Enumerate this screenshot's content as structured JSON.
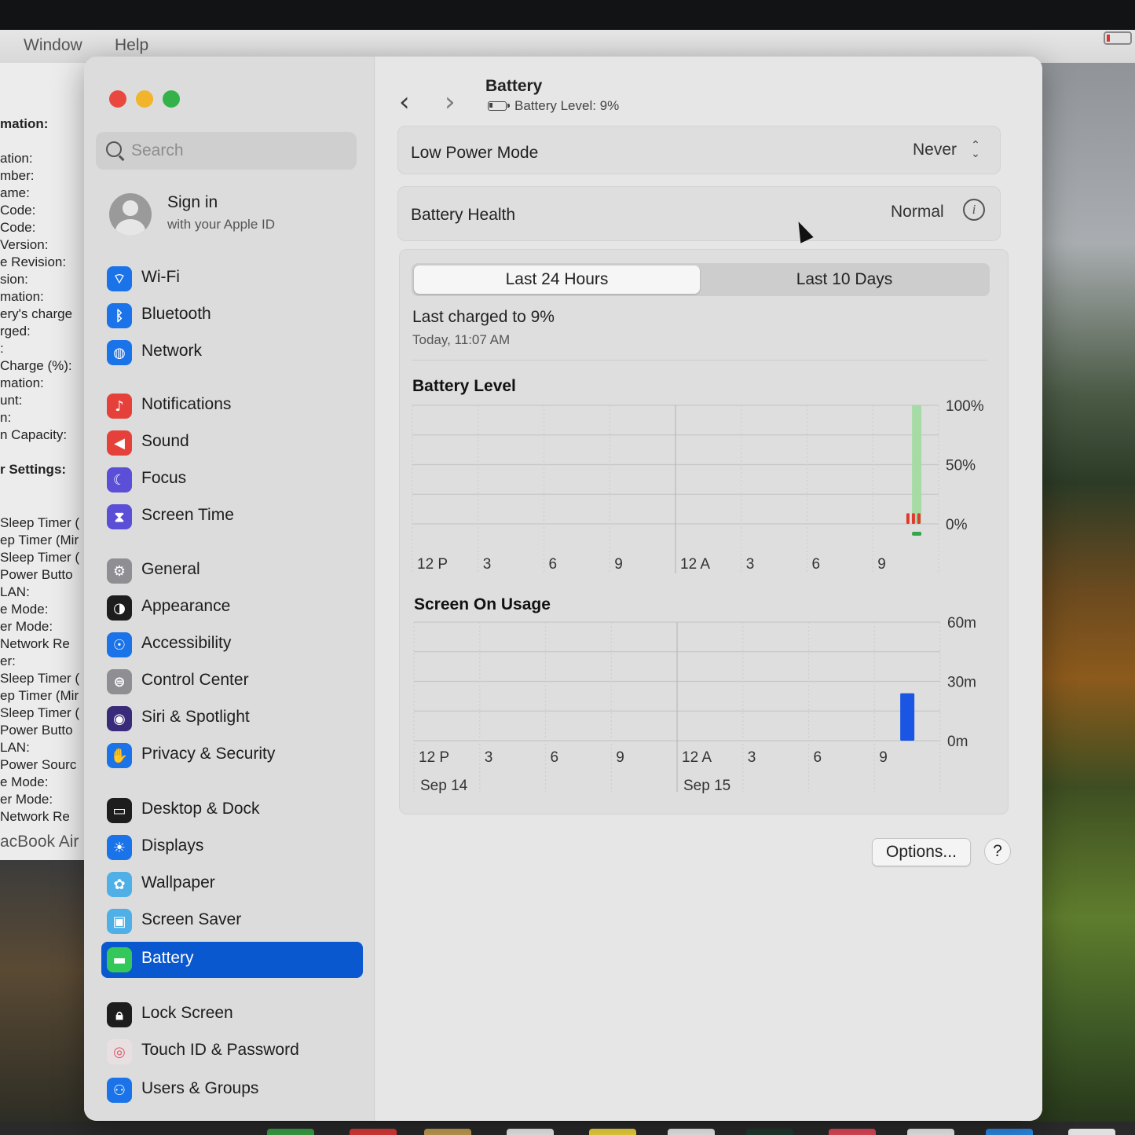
{
  "menubar": {
    "items": [
      "Window",
      "Help"
    ]
  },
  "info_window": {
    "lines": [
      "mation:",
      "ation:",
      "mber:",
      "ame:",
      "Code:",
      "Code:",
      "Version:",
      "e Revision:",
      "sion:",
      "mation:",
      "ery's charge",
      "rged:",
      ":",
      "Charge (%):",
      "mation:",
      "unt:",
      "n:",
      "n Capacity:",
      "r Settings:",
      "Sleep Timer (",
      "ep Timer (Mir",
      "Sleep Timer (",
      "Power Butto",
      "LAN:",
      "e Mode:",
      "er Mode:",
      "Network Re",
      "er:",
      "Sleep Timer (",
      "ep Timer (Mir",
      "Sleep Timer (",
      "Power Butto",
      "LAN:",
      "Power Sourc",
      "e Mode:",
      "er Mode:",
      "Network Re",
      "acBook Air"
    ]
  },
  "sidebar": {
    "search_placeholder": "Search",
    "account": {
      "title": "Sign in",
      "subtitle": "with your Apple ID"
    },
    "items": [
      {
        "label": "Wi-Fi",
        "icon": "wifi-icon",
        "color": "#1a73e8"
      },
      {
        "label": "Bluetooth",
        "icon": "bluetooth-icon",
        "color": "#1a73e8"
      },
      {
        "label": "Network",
        "icon": "globe-icon",
        "color": "#1a73e8"
      },
      {
        "label": "Notifications",
        "icon": "bell-icon",
        "color": "#e5413a"
      },
      {
        "label": "Sound",
        "icon": "speaker-icon",
        "color": "#e5413a"
      },
      {
        "label": "Focus",
        "icon": "moon-icon",
        "color": "#5a4fd6"
      },
      {
        "label": "Screen Time",
        "icon": "hourglass-icon",
        "color": "#5a4fd6"
      },
      {
        "label": "General",
        "icon": "gear-icon",
        "color": "#8e8e93"
      },
      {
        "label": "Appearance",
        "icon": "appearance-icon",
        "color": "#1d1d1d"
      },
      {
        "label": "Accessibility",
        "icon": "accessibility-icon",
        "color": "#1a73e8"
      },
      {
        "label": "Control Center",
        "icon": "toggles-icon",
        "color": "#8e8e93"
      },
      {
        "label": "Siri & Spotlight",
        "icon": "siri-icon",
        "color": "#3a2a7a"
      },
      {
        "label": "Privacy & Security",
        "icon": "hand-icon",
        "color": "#1a73e8"
      },
      {
        "label": "Desktop & Dock",
        "icon": "dock-icon",
        "color": "#1d1d1d"
      },
      {
        "label": "Displays",
        "icon": "sun-icon",
        "color": "#1a73e8"
      },
      {
        "label": "Wallpaper",
        "icon": "flower-icon",
        "color": "#4fb0e8"
      },
      {
        "label": "Screen Saver",
        "icon": "screensaver-icon",
        "color": "#4fb0e8"
      },
      {
        "label": "Battery",
        "icon": "battery-icon",
        "color": "#34c759",
        "active": true
      },
      {
        "label": "Lock Screen",
        "icon": "lock-icon",
        "color": "#1d1d1d"
      },
      {
        "label": "Touch ID & Password",
        "icon": "fingerprint-icon",
        "color": "#e8e0e0"
      },
      {
        "label": "Users & Groups",
        "icon": "users-icon",
        "color": "#1a73e8"
      }
    ]
  },
  "header": {
    "back": "‹",
    "forward": "›",
    "title": "Battery",
    "subtitle": "Battery Level: 9%"
  },
  "low_power": {
    "label": "Low Power Mode",
    "value": "Never"
  },
  "health": {
    "label": "Battery Health",
    "value": "Normal"
  },
  "tabs": {
    "active": "Last 24 Hours",
    "inactive": "Last 10 Days"
  },
  "last_charged": {
    "title": "Last charged to 9%",
    "time": "Today, 11:07 AM"
  },
  "chart_data": [
    {
      "type": "bar",
      "title": "Battery Level",
      "x_ticks": [
        "12 P",
        "3",
        "6",
        "9",
        "12 A",
        "3",
        "6",
        "9"
      ],
      "y_ticks": [
        "100%",
        "50%",
        "0%"
      ],
      "ylim": [
        0,
        100
      ],
      "series": [
        {
          "values_at_hour": [
            [
              23,
              100
            ]
          ],
          "color": "#a6dba6"
        },
        {
          "values_at_hour": [
            [
              22.6,
              9
            ],
            [
              22.85,
              9
            ],
            [
              23.1,
              9
            ]
          ],
          "color": "#e03a2f"
        }
      ]
    },
    {
      "type": "bar",
      "title": "Screen On Usage",
      "x_ticks": [
        "12 P",
        "3",
        "6",
        "9",
        "12 A",
        "3",
        "6",
        "9"
      ],
      "y_ticks": [
        "60m",
        "30m",
        "0m"
      ],
      "date_labels": [
        "Sep 14",
        "Sep 15"
      ],
      "ylim": [
        0,
        60
      ],
      "series": [
        {
          "values_at_hour": [
            [
              22.5,
              24
            ]
          ],
          "color": "#1a55e3"
        }
      ]
    }
  ],
  "footer": {
    "options_label": "Options...",
    "help_label": "?"
  }
}
